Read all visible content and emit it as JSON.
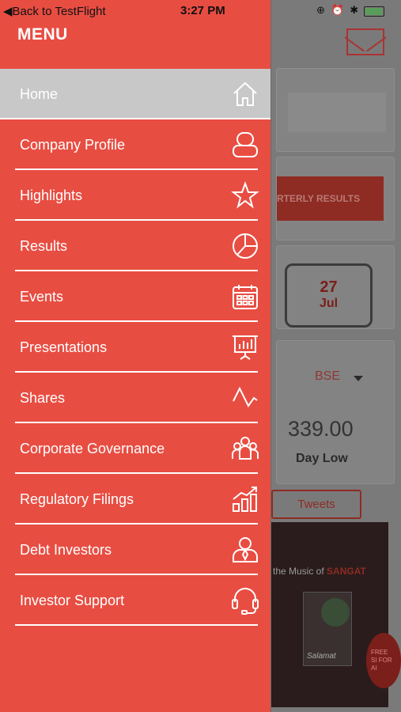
{
  "status": {
    "back_label": "Back to TestFlight",
    "back_arrow": "◀",
    "time": "3:27 PM",
    "right_icons": "⊕ ⏰ ✱"
  },
  "menu": {
    "title": "MENU",
    "items": [
      {
        "label": "Home",
        "icon": "home-icon"
      },
      {
        "label": "Company Profile",
        "icon": "profile-icon"
      },
      {
        "label": "Highlights",
        "icon": "star-icon"
      },
      {
        "label": "Results",
        "icon": "pie-chart-icon"
      },
      {
        "label": "Events",
        "icon": "calendar-icon"
      },
      {
        "label": "Presentations",
        "icon": "presentation-icon"
      },
      {
        "label": "Shares",
        "icon": "line-chart-icon"
      },
      {
        "label": "Corporate Governance",
        "icon": "group-icon"
      },
      {
        "label": "Regulatory Filings",
        "icon": "bar-chart-icon"
      },
      {
        "label": "Debt Investors",
        "icon": "investor-icon"
      },
      {
        "label": "Investor Support",
        "icon": "headset-icon"
      }
    ],
    "active_index": 0
  },
  "background": {
    "quarterly_button": "RTERLY RESULTS",
    "calendar_day": "27",
    "calendar_month": "Jul",
    "exchange": "BSE",
    "price": "339.00",
    "price_label": "Day Low",
    "tweets_label": "Tweets",
    "video_text_prefix": "the Music of ",
    "video_text_brand": "SANGAT",
    "video_poster_text": "Salamat",
    "video_badge_text": "FREE SI FOR AI"
  },
  "colors": {
    "drawer": "#e84d42",
    "active_item": "#c8c8c8",
    "text": "#ffffff"
  }
}
